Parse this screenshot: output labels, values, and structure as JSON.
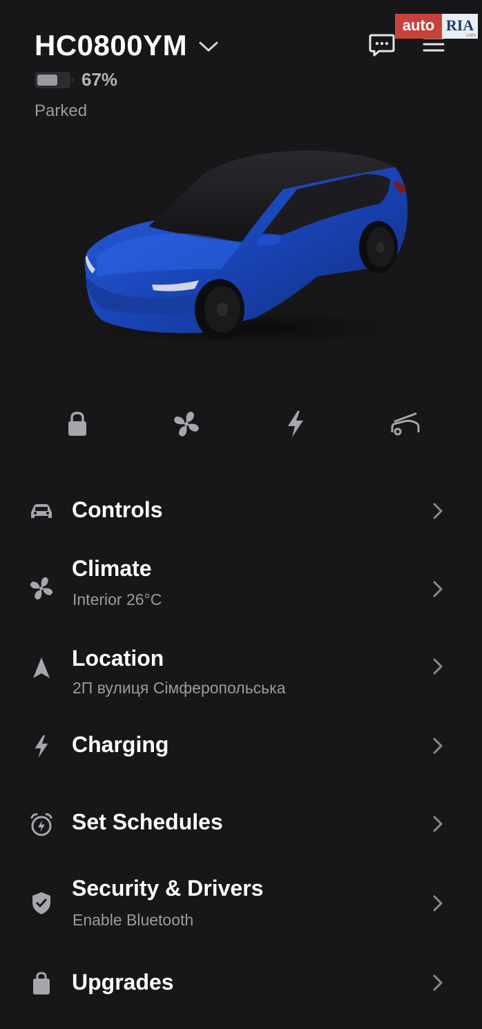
{
  "vehicle": {
    "name": "HC0800YM",
    "battery_percent_label": "67%",
    "battery_level": 0.67,
    "status": "Parked"
  },
  "watermark": {
    "brand_part1": "auto",
    "brand_part2": "RIA",
    "domain": ".com"
  },
  "top_icons": [
    "chevron-down-icon",
    "chat-icon",
    "menu-icon"
  ],
  "quick_controls": [
    "lock-icon",
    "fan-icon",
    "charge-bolt-icon",
    "frunk-icon"
  ],
  "menu": [
    {
      "label": "Controls",
      "subtitle": "",
      "icon": "car-icon"
    },
    {
      "label": "Climate",
      "subtitle": "Interior 26°C",
      "icon": "fan-icon"
    },
    {
      "label": "Location",
      "subtitle": "2П вулиця Сімферопольська",
      "icon": "navigation-arrow-icon"
    },
    {
      "label": "Charging",
      "subtitle": "",
      "icon": "bolt-icon"
    },
    {
      "label": "Set Schedules",
      "subtitle": "",
      "icon": "alarm-clock-icon"
    },
    {
      "label": "Security & Drivers",
      "subtitle": "Enable Bluetooth",
      "icon": "shield-icon"
    },
    {
      "label": "Upgrades",
      "subtitle": "",
      "icon": "shopping-bag-icon"
    }
  ],
  "colors": {
    "background": "#171719",
    "text_primary": "#ffffff",
    "text_secondary": "#9c9c9f",
    "icon": "#a7a7ab",
    "car_paint": "#1d4fc9"
  }
}
